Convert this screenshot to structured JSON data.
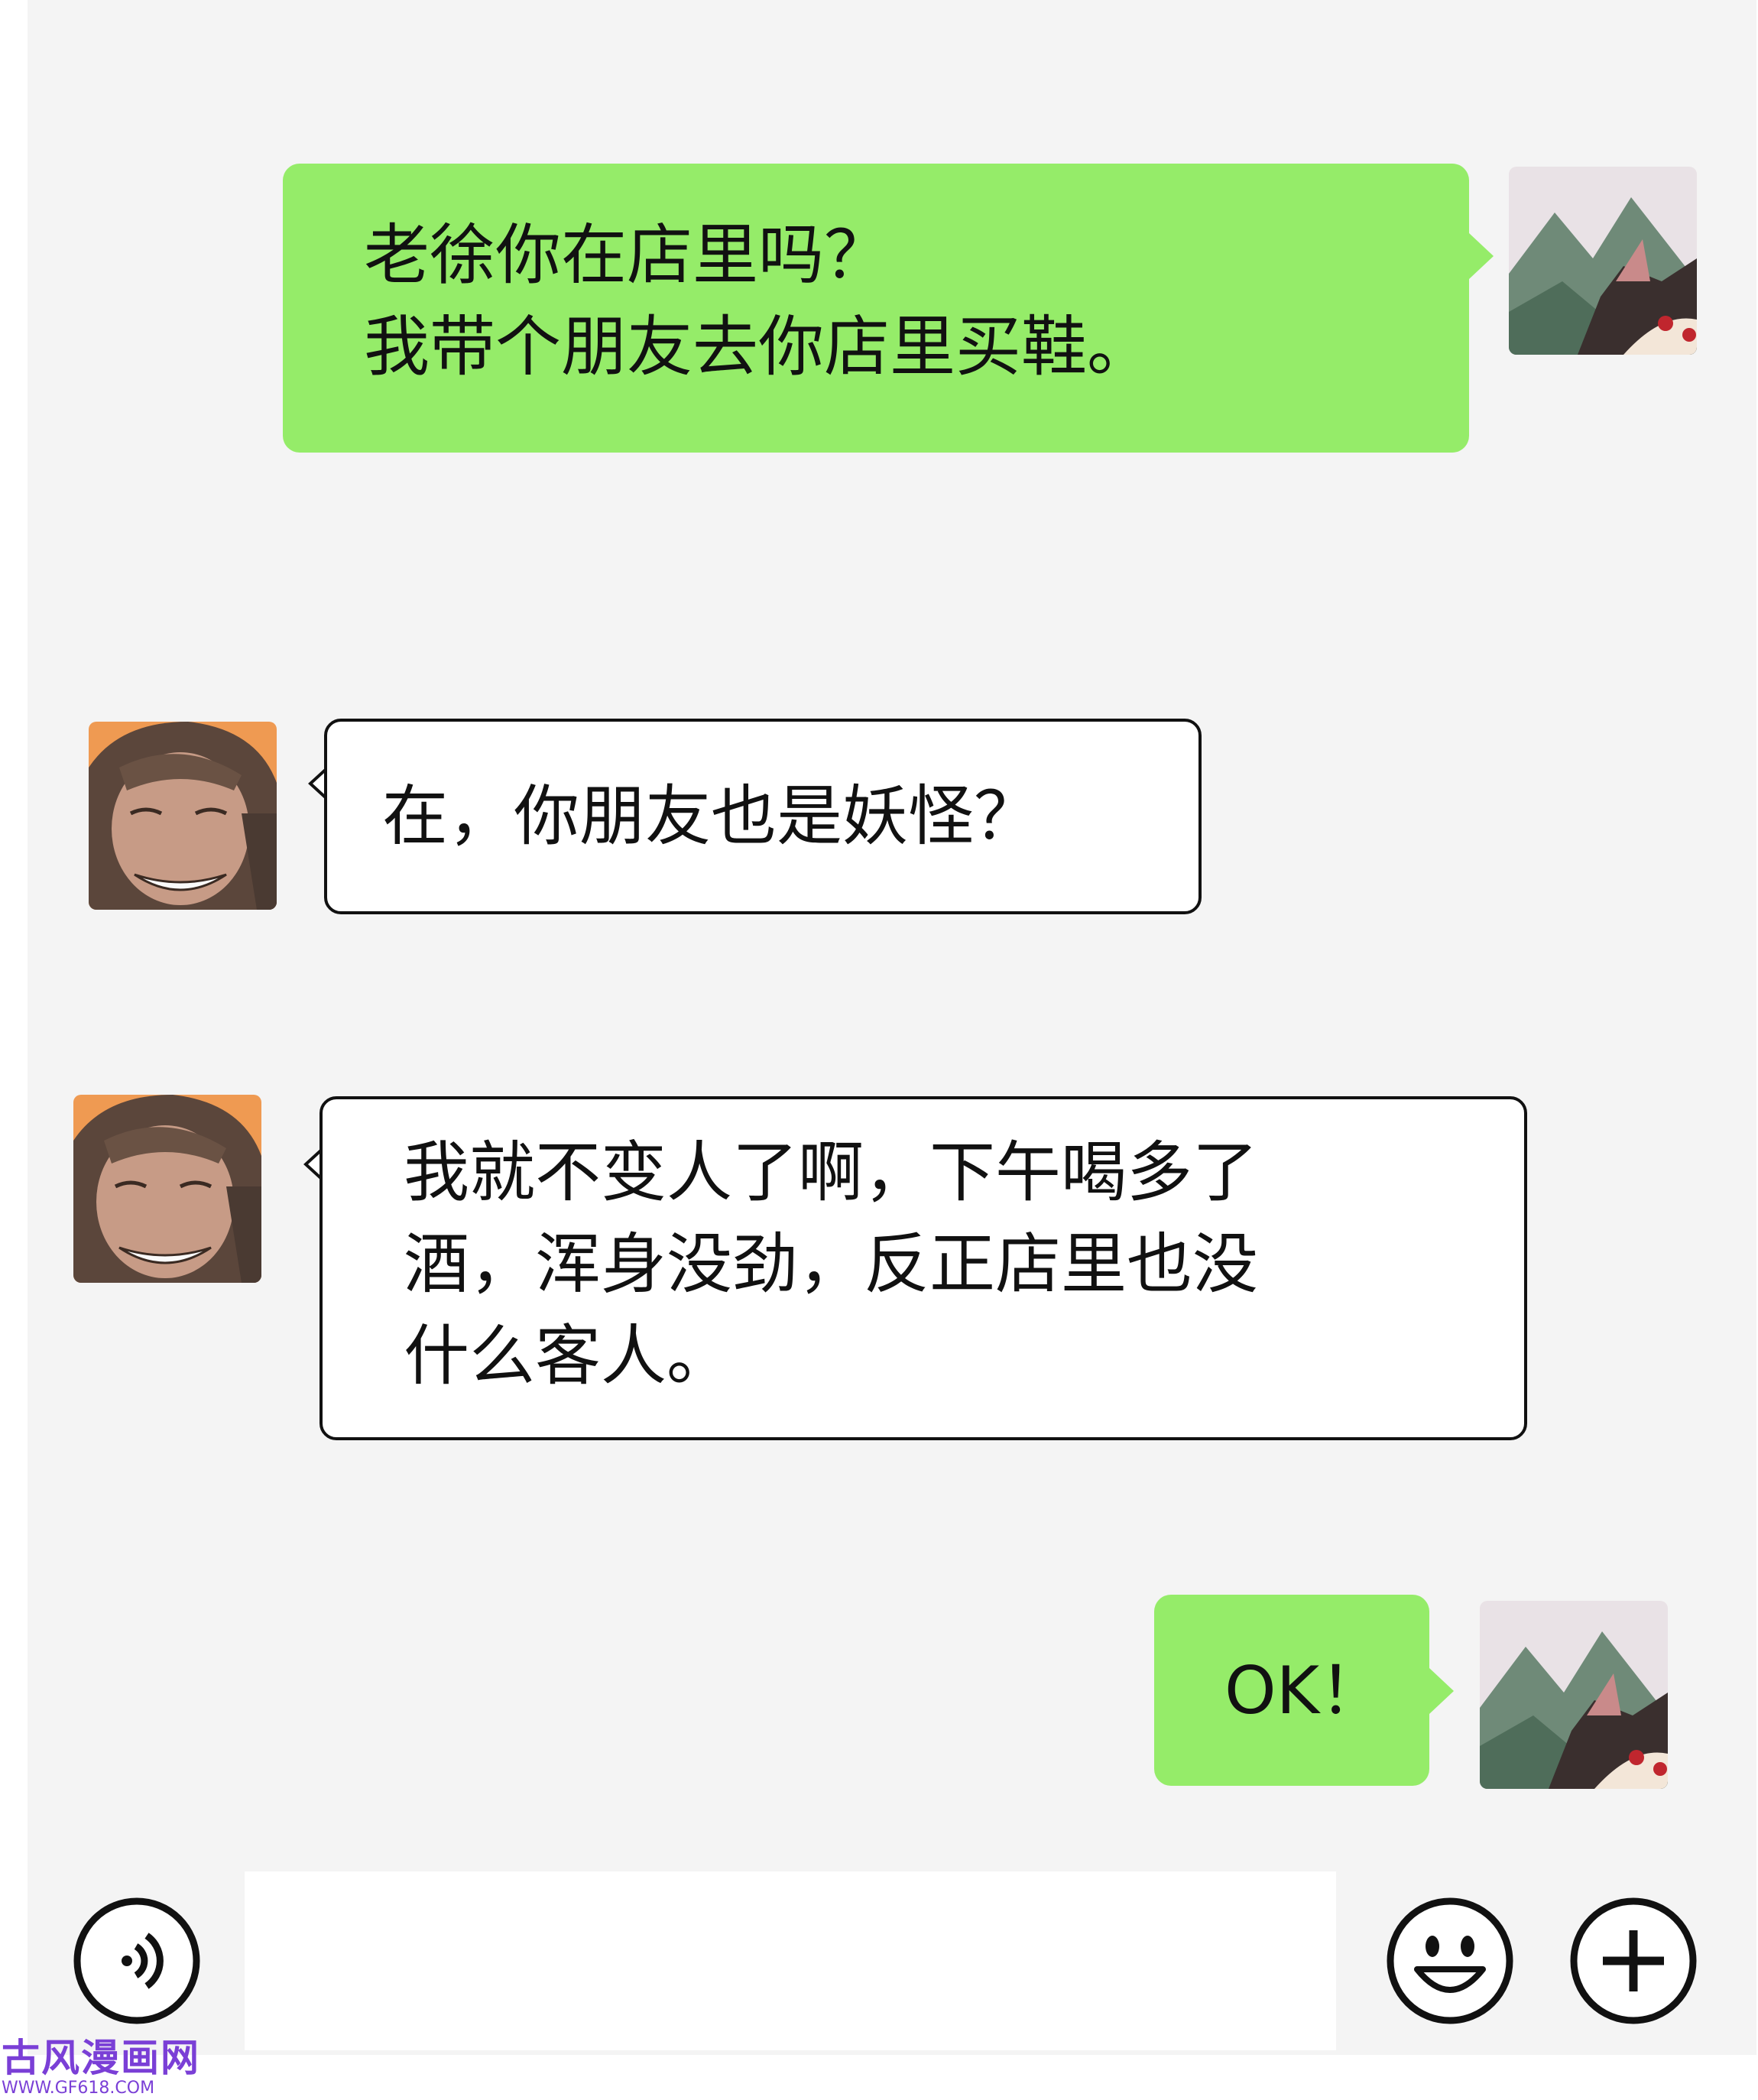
{
  "messages": [
    {
      "sender": "me",
      "lines": [
        "老徐你在店里吗？",
        "我带个朋友去你店里买鞋。"
      ]
    },
    {
      "sender": "friend",
      "lines": [
        "在，你朋友也是妖怪？"
      ]
    },
    {
      "sender": "friend",
      "lines": [
        "我就不变人了啊，下午喝多了",
        "酒，浑身没劲，反正店里也没",
        "什么客人。"
      ]
    },
    {
      "sender": "me",
      "lines": [
        "OK！"
      ]
    }
  ],
  "input": {
    "value": ""
  },
  "icons": {
    "voice": "voice-icon",
    "emoji": "emoji-icon",
    "more": "plus-icon"
  },
  "colors": {
    "my_bubble": "#95ec69",
    "their_bubble": "#ffffff",
    "chat_bg": "#f4f4f4"
  },
  "watermark": {
    "title": "古风漫画网",
    "url": "WWW.GF618.COM"
  }
}
